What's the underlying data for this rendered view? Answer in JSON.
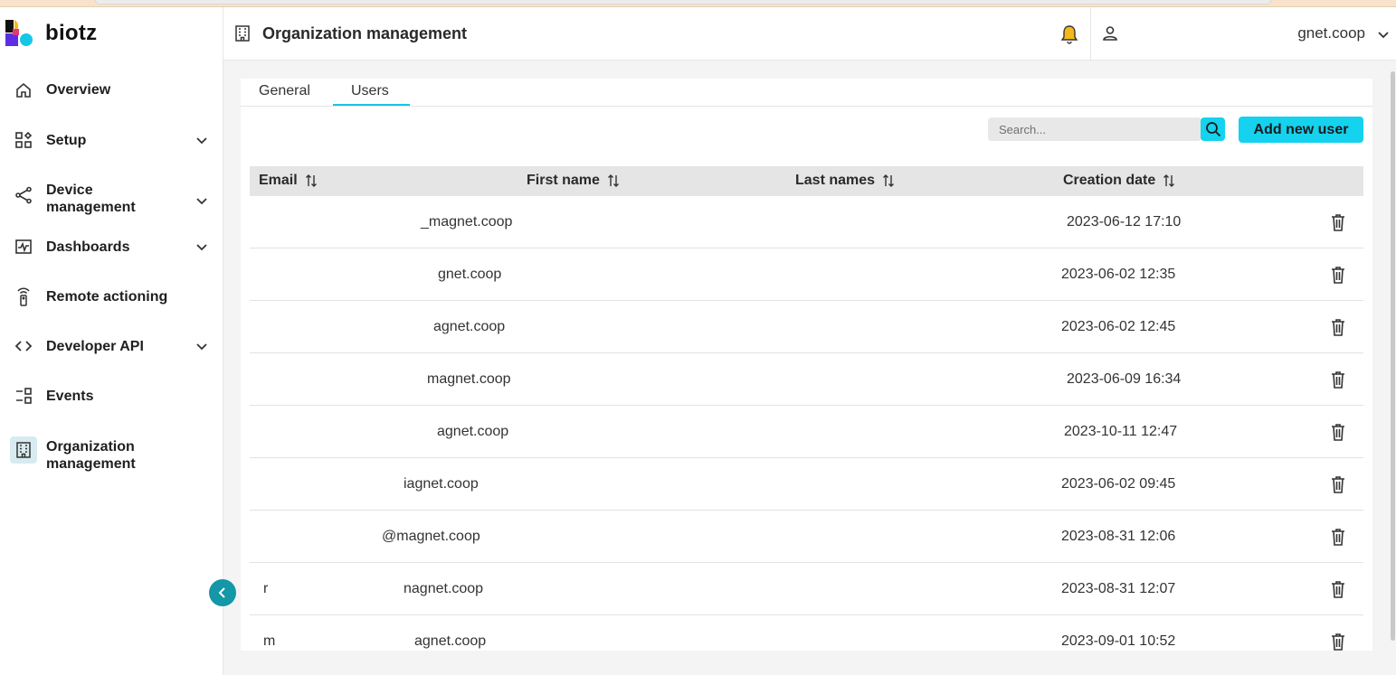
{
  "app": {
    "name": "biotz"
  },
  "header": {
    "title": "Organization management",
    "user_email": "gnet.coop"
  },
  "sidebar": {
    "items": [
      {
        "label": "Overview",
        "icon": "home-icon",
        "has_chevron": false
      },
      {
        "label": "Setup",
        "icon": "setup-grid-icon",
        "has_chevron": true
      },
      {
        "label": "Device\nmanagement",
        "icon": "share-nodes-icon",
        "has_chevron": true
      },
      {
        "label": "Dashboards",
        "icon": "dashboard-chart-icon",
        "has_chevron": true
      },
      {
        "label": "Remote actioning",
        "icon": "remote-icon",
        "has_chevron": false
      },
      {
        "label": "Developer API",
        "icon": "code-icon",
        "has_chevron": true
      },
      {
        "label": "Events",
        "icon": "events-icon",
        "has_chevron": false
      },
      {
        "label": "Organization\nmanagement",
        "icon": "building-icon",
        "has_chevron": false,
        "active": true
      }
    ]
  },
  "tabs": [
    {
      "label": "General",
      "active": false
    },
    {
      "label": "Users",
      "active": true
    }
  ],
  "search": {
    "placeholder": "Search..."
  },
  "actions": {
    "add_user_label": "Add new user"
  },
  "table": {
    "columns": [
      "Email",
      "First name",
      "Last names",
      "Creation date"
    ],
    "rows": [
      {
        "email": "_magnet.coop",
        "prefix": "",
        "date": "2023-06-12 17:10"
      },
      {
        "email": "gnet.coop",
        "prefix": "",
        "date": "2023-06-02 12:35"
      },
      {
        "email": "agnet.coop",
        "prefix": "",
        "date": "2023-06-02 12:45"
      },
      {
        "email": "magnet.coop",
        "prefix": "",
        "date": "2023-06-09 16:34"
      },
      {
        "email": "agnet.coop",
        "prefix": "",
        "date": "2023-10-11 12:47"
      },
      {
        "email": "iagnet.coop",
        "prefix": "",
        "date": "2023-06-02 09:45"
      },
      {
        "email": "@magnet.coop",
        "prefix": "",
        "date": "2023-08-31 12:06"
      },
      {
        "email": "nagnet.coop",
        "prefix": "r",
        "date": "2023-08-31 12:07"
      },
      {
        "email": "agnet.coop",
        "prefix": "m",
        "date": "2023-09-01 10:52"
      }
    ]
  },
  "colors": {
    "accent": "#15d2ee",
    "collapse_button": "#1497a6",
    "active_icon_bg": "#d7ebf0",
    "table_header_bg": "#e5e5e5",
    "main_bg": "#f4f4f4"
  }
}
